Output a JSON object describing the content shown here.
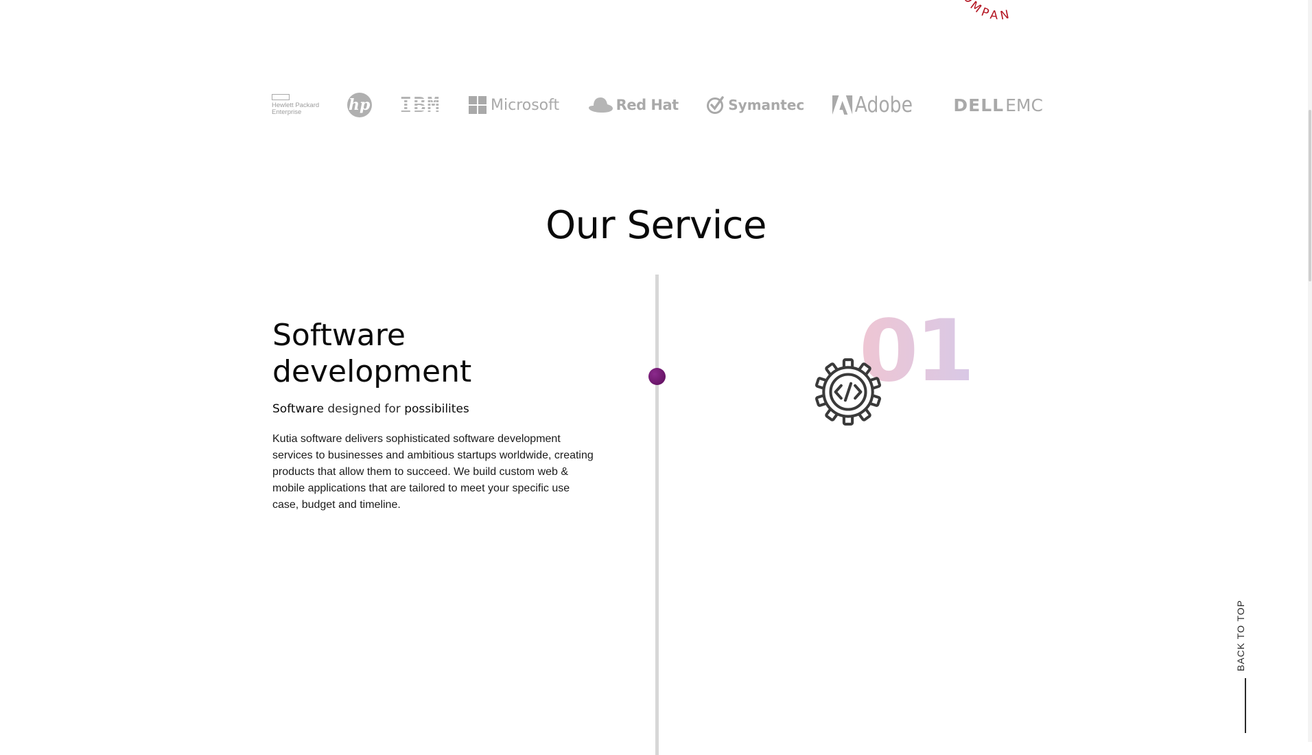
{
  "badge": {
    "text": "COMPAN"
  },
  "partners": [
    {
      "name": "Hewlett Packard Enterprise",
      "line1": "Hewlett Packard",
      "line2": "Enterprise"
    },
    {
      "name": "hp",
      "text": "hp"
    },
    {
      "name": "IBM",
      "text": "IBM"
    },
    {
      "name": "Microsoft",
      "text": "Microsoft"
    },
    {
      "name": "Red Hat",
      "text": "Red Hat"
    },
    {
      "name": "Symantec",
      "text": "Symantec"
    },
    {
      "name": "Adobe",
      "text": "Adobe"
    },
    {
      "name": "DELL EMC",
      "part1": "DELL",
      "part2": "EMC"
    }
  ],
  "section": {
    "title": "Our Service"
  },
  "service": {
    "number": "01",
    "title": "Software development",
    "subtitle_word1": "Software",
    "subtitle_mid": " designed for ",
    "subtitle_word2": "possibilites",
    "description": "Kutia software delivers sophisticated software development services to businesses and ambitious startups worldwide, creating products that allow them to succeed. We build custom web & mobile applications that are tailored to meet your specific use case, budget and timeline.",
    "icon": "gear-code-icon"
  },
  "back_to_top": {
    "label": "BACK TO TOP"
  },
  "colors": {
    "accent": "#b3121f",
    "dot": "#6e1670",
    "number_gradient": [
      "#efc6d3",
      "#d8c8e6"
    ]
  }
}
